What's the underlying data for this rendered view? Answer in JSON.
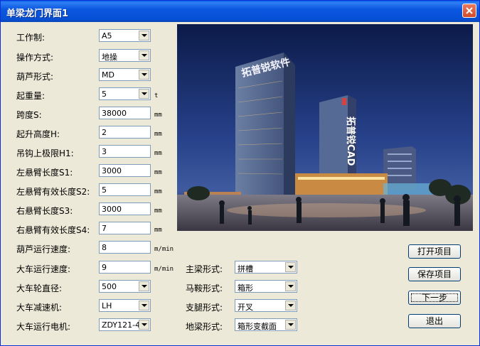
{
  "window": {
    "title": "单梁龙门界面1"
  },
  "left_params": [
    {
      "label": "工作制:",
      "type": "combo",
      "value": "A5",
      "unit": ""
    },
    {
      "label": "操作方式:",
      "type": "combo",
      "value": "地操",
      "unit": ""
    },
    {
      "label": "葫芦形式:",
      "type": "combo",
      "value": "MD",
      "unit": ""
    },
    {
      "label": "起重量:",
      "type": "combo",
      "value": "5",
      "unit": "t"
    },
    {
      "label": "跨度S:",
      "type": "field",
      "value": "38000",
      "unit": "mm"
    },
    {
      "label": "起升高度H:",
      "type": "field",
      "value": "2",
      "unit": "mm"
    },
    {
      "label": "吊钩上极限H1:",
      "type": "field",
      "value": "3",
      "unit": "mm"
    },
    {
      "label": "左悬臂长度S1:",
      "type": "field",
      "value": "3000",
      "unit": "mm"
    },
    {
      "label": "左悬臂有效长度S2:",
      "type": "field",
      "value": "5",
      "unit": "mm"
    },
    {
      "label": "右悬臂长度S3:",
      "type": "field",
      "value": "3000",
      "unit": "mm"
    },
    {
      "label": "右悬臂有效长度S4:",
      "type": "field",
      "value": "7",
      "unit": "mm"
    },
    {
      "label": "葫芦运行速度:",
      "type": "field",
      "value": "8",
      "unit": "m/min"
    },
    {
      "label": "大车运行速度:",
      "type": "field",
      "value": "9",
      "unit": "m/min"
    },
    {
      "label": "大车轮直径:",
      "type": "combo",
      "value": "500",
      "unit": ""
    },
    {
      "label": "大车减速机:",
      "type": "combo",
      "value": "LH",
      "unit": ""
    },
    {
      "label": "大车运行电机:",
      "type": "combo",
      "value": "ZDY121-4",
      "unit": ""
    }
  ],
  "right_params": [
    {
      "label": "主梁形式:",
      "value": "拼槽"
    },
    {
      "label": "马鞍形式:",
      "value": "箱形"
    },
    {
      "label": "支腿形式:",
      "value": "开叉"
    },
    {
      "label": "地梁形式:",
      "value": "箱形变截面"
    }
  ],
  "buttons": {
    "open": "打开项目",
    "save": "保存项目",
    "next": "下一步",
    "exit": "退出"
  },
  "photo": {
    "sign_main": "拓普锐软件",
    "sign_side": "拓普锐CAD"
  }
}
